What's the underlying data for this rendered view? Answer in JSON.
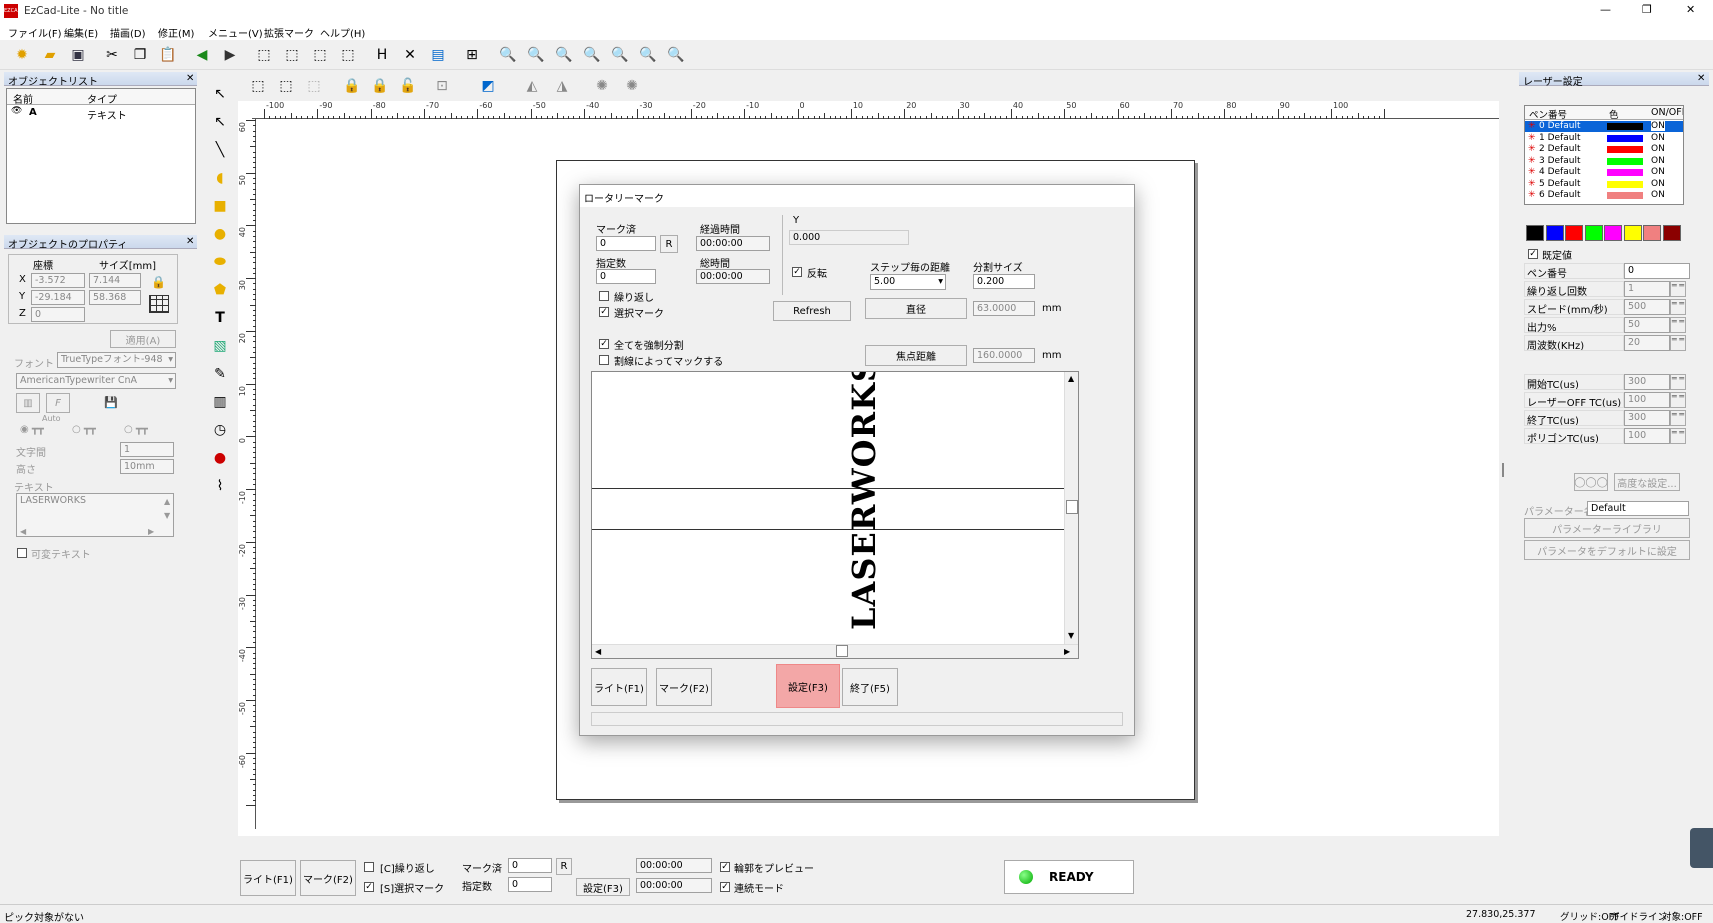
{
  "app": {
    "title": "EzCad-Lite - No title",
    "logo": "EZCAD"
  },
  "window_controls": {
    "minimize": "—",
    "restore": "❐",
    "close": "✕"
  },
  "menu": [
    "ファイル(F)",
    "編集(E)",
    "描画(D)",
    "修正(M)",
    "メニュー(V)",
    "拡張マーク",
    "ヘルプ(H)"
  ],
  "object_list": {
    "title": "オブジェクトリスト",
    "col_name": "名前",
    "col_type": "タイプ",
    "rows": [
      {
        "name": "A",
        "type": "テキスト"
      }
    ]
  },
  "props": {
    "title": "オブジェクトのプロパティ",
    "coord_label": "座標",
    "size_label": "サイズ[mm]",
    "x_label": "X",
    "y_label": "Y",
    "z_label": "Z",
    "x": "-3.572",
    "y": "-29.184",
    "z": "0",
    "w": "7.144",
    "h": "58.368",
    "apply": "適用(A)",
    "font_label": "フォント",
    "font_type": "TrueTypeフォント-948",
    "font_name": "AmericanTypewriter CnA",
    "auto": "Auto",
    "char_spacing_label": "文字間",
    "char_spacing": "1",
    "height_label": "高さ",
    "height": "10mm",
    "text_label": "テキスト",
    "text": "LASERWORKS",
    "variable_text": "可変テキスト"
  },
  "ruler": {
    "h": [
      "-100",
      "-90",
      "-80",
      "-70",
      "-60",
      "-50",
      "-40",
      "-30",
      "-20",
      "-10",
      "0",
      "10",
      "20",
      "30",
      "40",
      "50",
      "60",
      "70",
      "80",
      "90",
      "100"
    ],
    "v": [
      "60",
      "50",
      "40",
      "30",
      "20",
      "10",
      "0",
      "-10",
      "-20",
      "-30",
      "-40",
      "-50",
      "-60"
    ]
  },
  "rotary": {
    "title": "ロータリーマーク",
    "marked_label": "マーク済",
    "marked": "0",
    "r": "R",
    "specified_label": "指定数",
    "specified": "0",
    "elapsed_label": "経過時間",
    "elapsed": "00:00:00",
    "total_label": "総時間",
    "total": "00:00:00",
    "y_label": "Y",
    "y": "0.000",
    "reverse_label": "反転",
    "step_label": "ステップ毎の距離",
    "step": "5.00",
    "split_label": "分割サイズ",
    "split": "0.200",
    "repeat_label": "繰り返し",
    "select_mark_label": "選択マーク",
    "refresh": "Refresh",
    "diameter": "直径",
    "diameter_value": "63.0000",
    "mm": "mm",
    "force_split": "全てを強制分割",
    "split_by_line": "割線によってマックする",
    "focal": "焦点距離",
    "focal_value": "160.0000",
    "preview_text": "LASERWORKS",
    "light": "ライト(F1)",
    "mark": "マーク(F2)",
    "settings": "設定(F3)",
    "end": "終了(F5)"
  },
  "bottom": {
    "light": "ライト(F1)",
    "mark": "マーク(F2)",
    "repeat": "[C]繰り返し",
    "select_mark": "[S]選択マーク",
    "marked_label": "マーク済",
    "marked": "0",
    "r": "R",
    "specified_label": "指定数",
    "specified": "0",
    "settings": "設定(F3)",
    "time1": "00:00:00",
    "time2": "00:00:00",
    "preview_outline": "輪郭をプレビュー",
    "continuous": "連続モード",
    "ready": "READY"
  },
  "laser": {
    "title": "レーザー設定",
    "col_pen": "ペン番号",
    "col_color": "色",
    "col_on": "ON/OFF",
    "pens": [
      {
        "name": "0 Default",
        "color": "#000000",
        "on": "ON"
      },
      {
        "name": "1 Default",
        "color": "#0000ff",
        "on": "ON"
      },
      {
        "name": "2 Default",
        "color": "#ff0000",
        "on": "ON"
      },
      {
        "name": "3 Default",
        "color": "#00ff00",
        "on": "ON"
      },
      {
        "name": "4 Default",
        "color": "#ff00ff",
        "on": "ON"
      },
      {
        "name": "5 Default",
        "color": "#ffff00",
        "on": "ON"
      },
      {
        "name": "6 Default",
        "color": "#f08080",
        "on": "ON"
      }
    ],
    "palette": [
      "#000000",
      "#0000ff",
      "#ff0000",
      "#00ff00",
      "#ff00ff",
      "#ffff00",
      "#f08080",
      "#8b0000"
    ],
    "default_value": "既定値",
    "params": [
      {
        "label": "ペン番号",
        "value": "0"
      },
      {
        "label": "繰り返し回数",
        "value": "1"
      },
      {
        "label": "スピード(mm/秒)",
        "value": "500"
      },
      {
        "label": "出力%",
        "value": "50"
      },
      {
        "label": "周波数(KHz)",
        "value": "20"
      },
      {
        "label": "開始TC(us)",
        "value": "300"
      },
      {
        "label": "レーザーOFF TC(us)",
        "value": "100"
      },
      {
        "label": "終了TC(us)",
        "value": "300"
      },
      {
        "label": "ポリゴンTC(us)",
        "value": "100"
      }
    ],
    "advanced": "高度な設定...",
    "param_name_label": "パラメーター名",
    "param_name": "Default",
    "library": "パラメーターライブラリ",
    "set_default": "パラメータをデフォルトに設定"
  },
  "status": {
    "message": "ピック対象がない",
    "coords": "27.830,25.377",
    "grid": "グリッド:OFF",
    "guide": "ガイドライン",
    "object": "対象:OFF"
  }
}
